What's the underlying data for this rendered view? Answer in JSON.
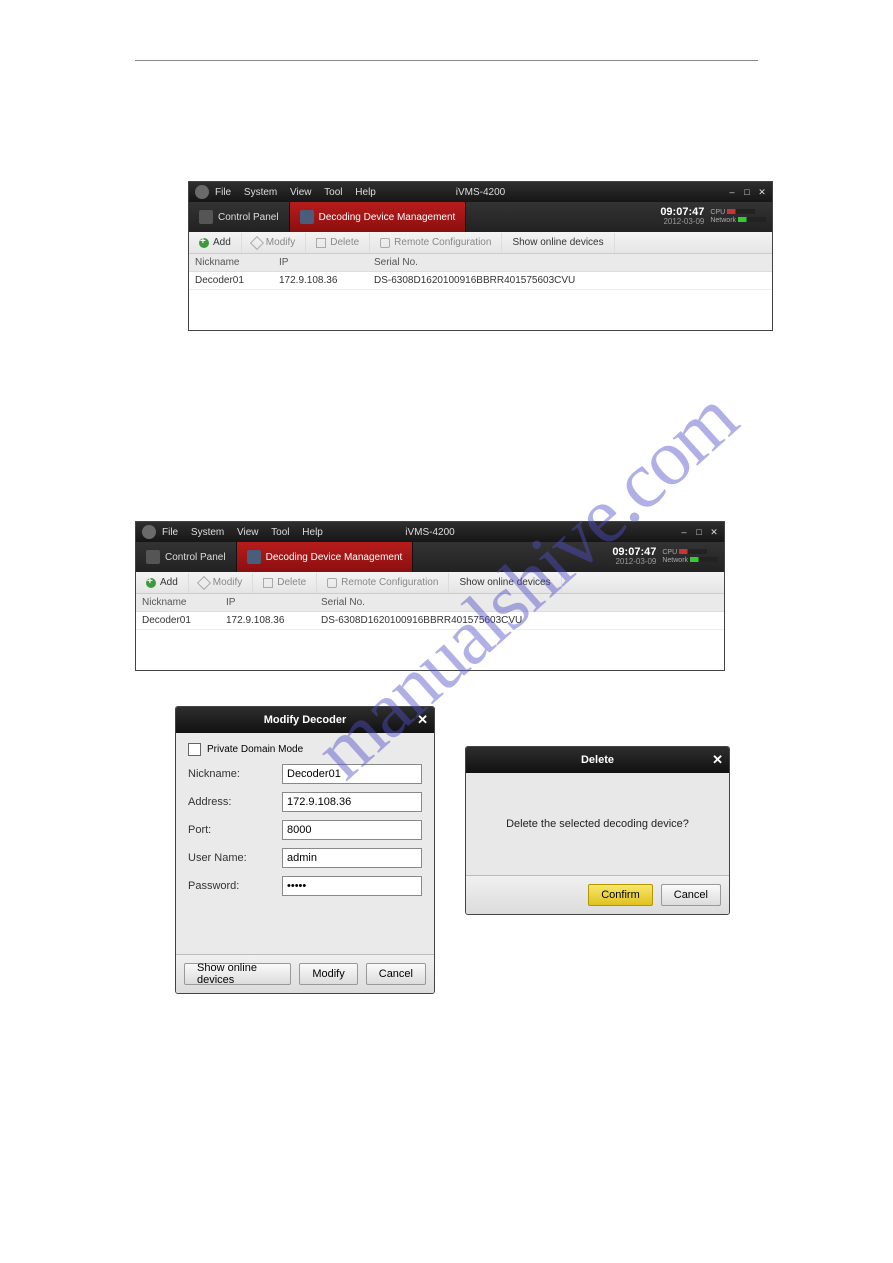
{
  "app": {
    "title": "iVMS-4200",
    "menus": [
      "File",
      "System",
      "View",
      "Tool",
      "Help"
    ],
    "tabs": {
      "control_panel": "Control Panel",
      "active": "Decoding Device Management"
    },
    "clock": {
      "time": "09:07:47",
      "date": "2012-03-09"
    },
    "meters": {
      "cpu": "CPU",
      "net": "Network"
    },
    "toolbar": {
      "add": "Add",
      "modify": "Modify",
      "delete": "Delete",
      "remote_cfg": "Remote Configuration",
      "show_online": "Show online devices"
    },
    "columns": {
      "nickname": "Nickname",
      "ip": "IP",
      "serial": "Serial No."
    },
    "rows": [
      {
        "nickname": "Decoder01",
        "ip": "172.9.108.36",
        "serial": "DS-6308D1620100916BBRR401575603CVU"
      }
    ]
  },
  "modify_dialog": {
    "title": "Modify Decoder",
    "private_domain": "Private Domain Mode",
    "labels": {
      "nickname": "Nickname:",
      "address": "Address:",
      "port": "Port:",
      "user": "User Name:",
      "password": "Password:"
    },
    "values": {
      "nickname": "Decoder01",
      "address": "172.9.108.36",
      "port": "8000",
      "user": "admin",
      "password": "•••••"
    },
    "buttons": {
      "show_online": "Show online devices",
      "modify": "Modify",
      "cancel": "Cancel"
    }
  },
  "delete_dialog": {
    "title": "Delete",
    "message": "Delete the selected decoding device?",
    "buttons": {
      "confirm": "Confirm",
      "cancel": "Cancel"
    }
  },
  "watermark": "manualshive.com"
}
